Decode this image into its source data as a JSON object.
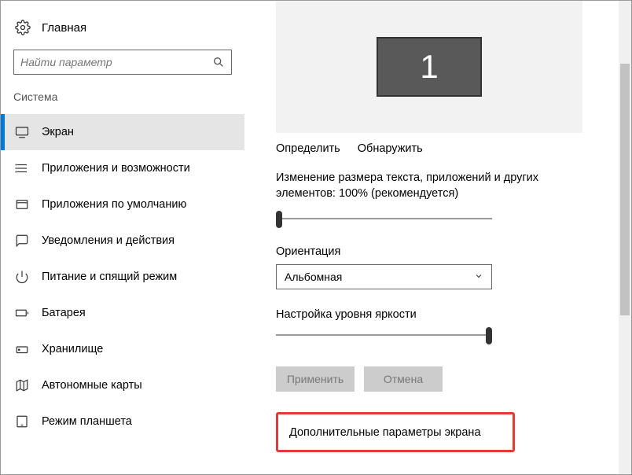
{
  "sidebar": {
    "home": "Главная",
    "search_placeholder": "Найти параметр",
    "category": "Система",
    "items": [
      {
        "label": "Экран",
        "active": true
      },
      {
        "label": "Приложения и возможности",
        "active": false
      },
      {
        "label": "Приложения по умолчанию",
        "active": false
      },
      {
        "label": "Уведомления и действия",
        "active": false
      },
      {
        "label": "Питание и спящий режим",
        "active": false
      },
      {
        "label": "Батарея",
        "active": false
      },
      {
        "label": "Хранилище",
        "active": false
      },
      {
        "label": "Автономные карты",
        "active": false
      },
      {
        "label": "Режим планшета",
        "active": false
      }
    ]
  },
  "content": {
    "monitor_number": "1",
    "identify": "Определить",
    "detect": "Обнаружить",
    "scale_text": "Изменение размера текста, приложений и других элементов: 100% (рекомендуется)",
    "orientation_label": "Ориентация",
    "orientation_value": "Альбомная",
    "brightness_label": "Настройка уровня яркости",
    "apply": "Применить",
    "cancel": "Отмена",
    "advanced": "Дополнительные параметры экрана"
  }
}
